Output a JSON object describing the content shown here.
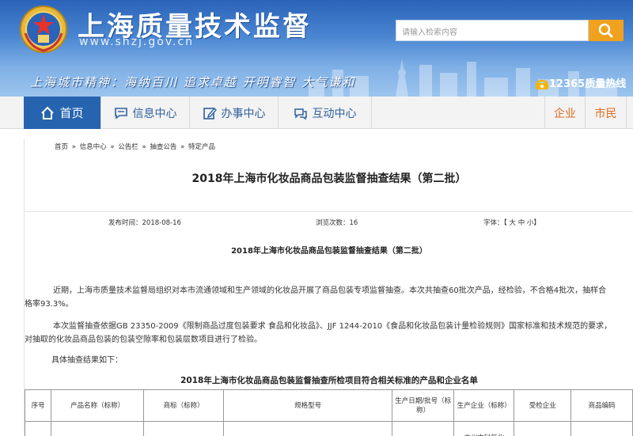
{
  "header": {
    "site_title": "上海质量技术监督",
    "site_url": "www.shzj.gov.cn",
    "search_placeholder": "请输入检索内容",
    "slogan": "上海城市精神：海纳百川 追求卓越 开明睿智 大气谦和",
    "hotline": "12365质量热线",
    "colors": {
      "header_top": "#2a63b8",
      "header_bottom": "#9cc4ee",
      "search_button": "#f0a11d"
    }
  },
  "nav": {
    "items": [
      {
        "label": "首页",
        "icon": "home-icon",
        "active": true
      },
      {
        "label": "信息中心",
        "icon": "chat-icon"
      },
      {
        "label": "办事中心",
        "icon": "edit-icon"
      },
      {
        "label": "互动中心",
        "icon": "comment-icon"
      }
    ],
    "right_items": [
      {
        "label": "企业"
      },
      {
        "label": "市民"
      }
    ],
    "colors": {
      "active_bg": "#2664b0",
      "right_text": "#e06b1d"
    }
  },
  "breadcrumb": [
    "首页",
    "»",
    "信息中心",
    "»",
    "公告栏",
    "»",
    "抽查公告",
    "»",
    "特定产品"
  ],
  "article": {
    "title": "2018年上海市化妆品商品包装监督抽查结果（第二批）",
    "publish_label": "发布时间：",
    "publish_date": "2018-08-16",
    "views_label": "浏览次数：",
    "views": "16",
    "font_label": "字体：【",
    "font_big": "大",
    "font_mid": "中",
    "font_small": "小",
    "font_end": "】",
    "sub_title": "2018年上海市化妆品商品包装监督抽查结果（第二批）",
    "paragraph1": "近期，上海市质量技术监督局组织对本市流通领域和生产领域的化妆品开展了商品包装专项监督抽查。本次共抽查60批次产品，经检验，不合格4批次，抽样合格率93.3%。",
    "paragraph2": "本次监督抽查依据GB 23350-2009《限制商品过度包装要求 食品和化妆品》、JJF 1244-2010《食品和化妆品包装计量检验规则》国家标准和技术规范的要求，对抽取的化妆品商品包装的包装空隙率和包装层数项目进行了检验。",
    "paragraph3": "具体抽查结果如下：",
    "table_title": "2018年上海市化妆品商品包装监督抽查所检项目符合相关标准的产品和企业名单"
  },
  "table": {
    "headers": [
      "序号",
      "产品名称（标称）",
      "商标（标称）",
      "规格型号",
      "生产日期/批号（标称）",
      "生产企业（标称）",
      "受检企业",
      "商品编码"
    ],
    "rows": [
      [
        "",
        "",
        "",
        "",
        "",
        "广州市科新化",
        "",
        ""
      ]
    ]
  }
}
